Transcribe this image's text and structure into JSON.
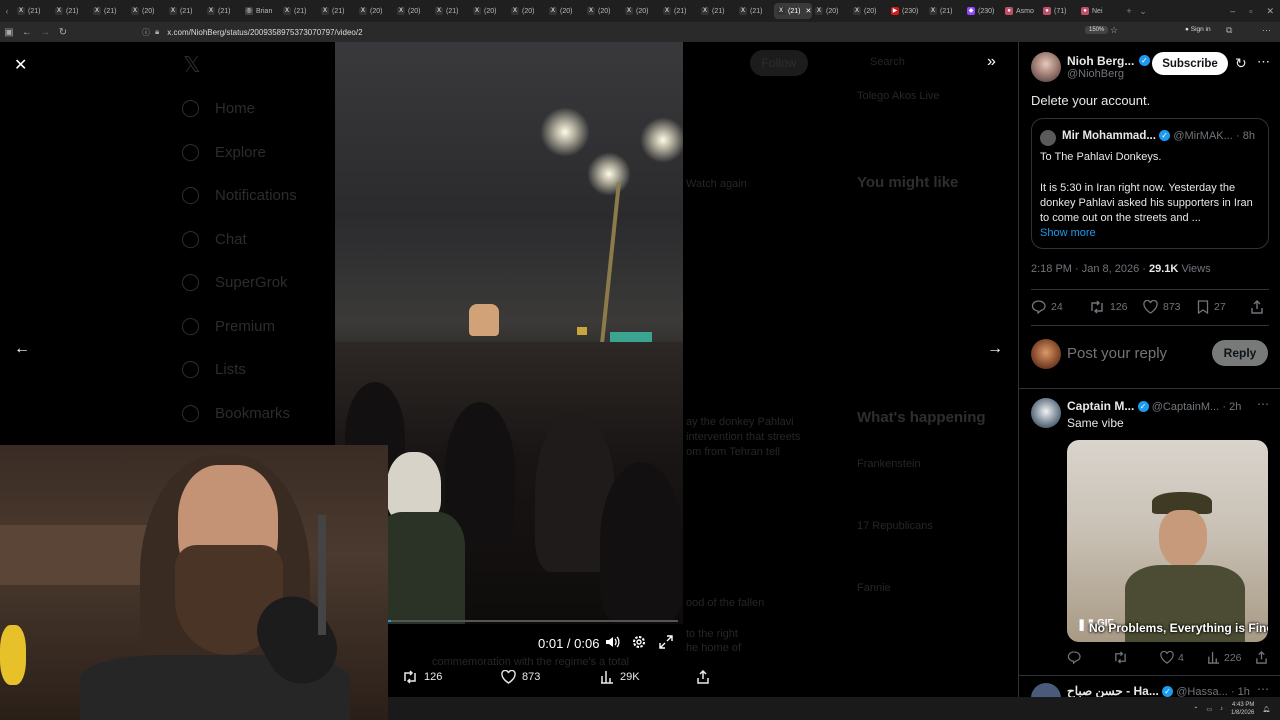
{
  "browser": {
    "tabs": [
      {
        "label": "(21)",
        "icon": "x-icon",
        "active": false
      },
      {
        "label": "(21)",
        "icon": "x-icon",
        "active": false
      },
      {
        "label": "(21)",
        "icon": "x-icon",
        "active": false
      },
      {
        "label": "(20)",
        "icon": "x-icon",
        "active": false
      },
      {
        "label": "(21)",
        "icon": "x-icon",
        "active": false
      },
      {
        "label": "(21)",
        "icon": "x-icon",
        "active": false
      },
      {
        "label": "Brian",
        "icon": "globe-icon",
        "active": false
      },
      {
        "label": "(21)",
        "icon": "x-icon",
        "active": false
      },
      {
        "label": "(21)",
        "icon": "x-icon",
        "active": false
      },
      {
        "label": "(20)",
        "icon": "x-icon",
        "active": false
      },
      {
        "label": "(20)",
        "icon": "x-icon",
        "active": false
      },
      {
        "label": "(21)",
        "icon": "x-icon",
        "active": false
      },
      {
        "label": "(20)",
        "icon": "x-icon",
        "active": false
      },
      {
        "label": "(20)",
        "icon": "x-icon",
        "active": false
      },
      {
        "label": "(20)",
        "icon": "x-icon",
        "active": false
      },
      {
        "label": "(20)",
        "icon": "x-icon",
        "active": false
      },
      {
        "label": "(20)",
        "icon": "x-icon",
        "active": false
      },
      {
        "label": "(21)",
        "icon": "x-icon",
        "active": false
      },
      {
        "label": "(21)",
        "icon": "x-icon",
        "active": false
      },
      {
        "label": "(21)",
        "icon": "x-icon",
        "active": false
      },
      {
        "label": "(21)",
        "icon": "x-icon",
        "active": true
      },
      {
        "label": "(20)",
        "icon": "x-icon",
        "active": false
      },
      {
        "label": "(20)",
        "icon": "x-icon",
        "active": false
      },
      {
        "label": "(230)",
        "icon": "youtube-icon",
        "active": false
      },
      {
        "label": "(21)",
        "icon": "x-icon",
        "active": false
      },
      {
        "label": "(230)",
        "icon": "twitch-icon",
        "active": false
      },
      {
        "label": "Asmo",
        "icon": "app-icon",
        "active": false
      },
      {
        "label": "(71)",
        "icon": "app-icon",
        "active": false
      },
      {
        "label": "Nei",
        "icon": "app-icon",
        "active": false
      }
    ],
    "url": "x.com/NiohBerg/status/2009358975373070797/video/2",
    "zoom": "150%",
    "signin": "Sign in"
  },
  "background_page": {
    "nav": [
      "Home",
      "Explore",
      "Notifications",
      "Chat",
      "SuperGrok",
      "Premium",
      "Lists",
      "Bookmarks"
    ],
    "follow_label": "Follow",
    "search_label": "Search",
    "sidebar_top": "Tolego Akos Live",
    "you_might_like": "You might like",
    "whats_happening": "What's happening",
    "trends": [
      "Frankenstein",
      "17 Republicans",
      "Fannie"
    ],
    "watch_again": "Watch again",
    "snippet": [
      "ay the donkey Pahlavi",
      "intervention that streets",
      "om from Tehran tell"
    ],
    "snippet2": "ood of the fallen",
    "snippet3": [
      "to the right",
      "he home of"
    ],
    "snippet4": "commemoration with the regime's a total"
  },
  "video": {
    "time": "0:01 / 0:06",
    "progress": 0.01,
    "retweets": "126",
    "likes": "873",
    "views": "29K"
  },
  "tweet": {
    "author_name": "Nioh Berg...",
    "author_handle": "@NiohBerg",
    "subscribe_label": "Subscribe",
    "text": "Delete your account.",
    "quote": {
      "author_name": "Mir Mohammad...",
      "author_handle": "@MirMAK...",
      "time": "· 8h",
      "line1": "To The Pahlavi Donkeys.",
      "line2": "It is 5:30 in Iran right now. Yesterday the donkey Pahlavi asked his supporters in Iran to come out on the streets and ...",
      "show_more": "Show more"
    },
    "timestamp": "2:18 PM · Jan 8, 2026 ·",
    "views_count": "29.1K",
    "views_label": "Views",
    "replies": "24",
    "retweets": "126",
    "likes": "873",
    "bookmarks": "27"
  },
  "reply_box": {
    "placeholder": "Post your reply",
    "button": "Reply"
  },
  "reply": {
    "author_name": "Captain M...",
    "author_handle": "@CaptainM...",
    "time": "· 2h",
    "text": "Same vibe",
    "gif_label": "GIF",
    "gif_caption": "No Problems, Everything is Fine",
    "retweets": "",
    "likes": "4",
    "views": "226"
  },
  "next_reply": {
    "author_name": "حسن صباح - Ha...",
    "author_handle": "@Hassa...",
    "time": "· 1h"
  },
  "taskbar": {
    "time": "4:43 PM",
    "date": "1/8/2026"
  },
  "colors": {
    "accent": "#1d9bf0",
    "text": "#e7e9ea",
    "muted": "#71767b",
    "border": "#2f3336"
  }
}
